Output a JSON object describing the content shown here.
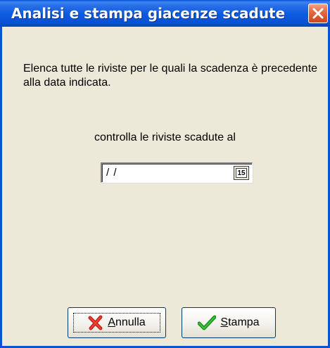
{
  "window": {
    "title": "Analisi e stampa giacenze scadute",
    "close_icon": "close-icon"
  },
  "description": "Elenca tutte le riviste per le quali la scadenza è precedente alla data indicata.",
  "date_prompt": "controlla le riviste scadute al",
  "date_field": {
    "value": " / /",
    "calendar_icon": "calendar-icon",
    "calendar_day": "15"
  },
  "buttons": {
    "cancel": {
      "mnemonic": "A",
      "rest": "nnulla",
      "icon": "red-x-icon"
    },
    "print": {
      "mnemonic": "S",
      "rest": "tampa",
      "icon": "green-check-icon"
    }
  },
  "colors": {
    "titlebar": "#0A51D3",
    "window_bg": "#ECE9D8",
    "close_red": "#D0451C"
  }
}
